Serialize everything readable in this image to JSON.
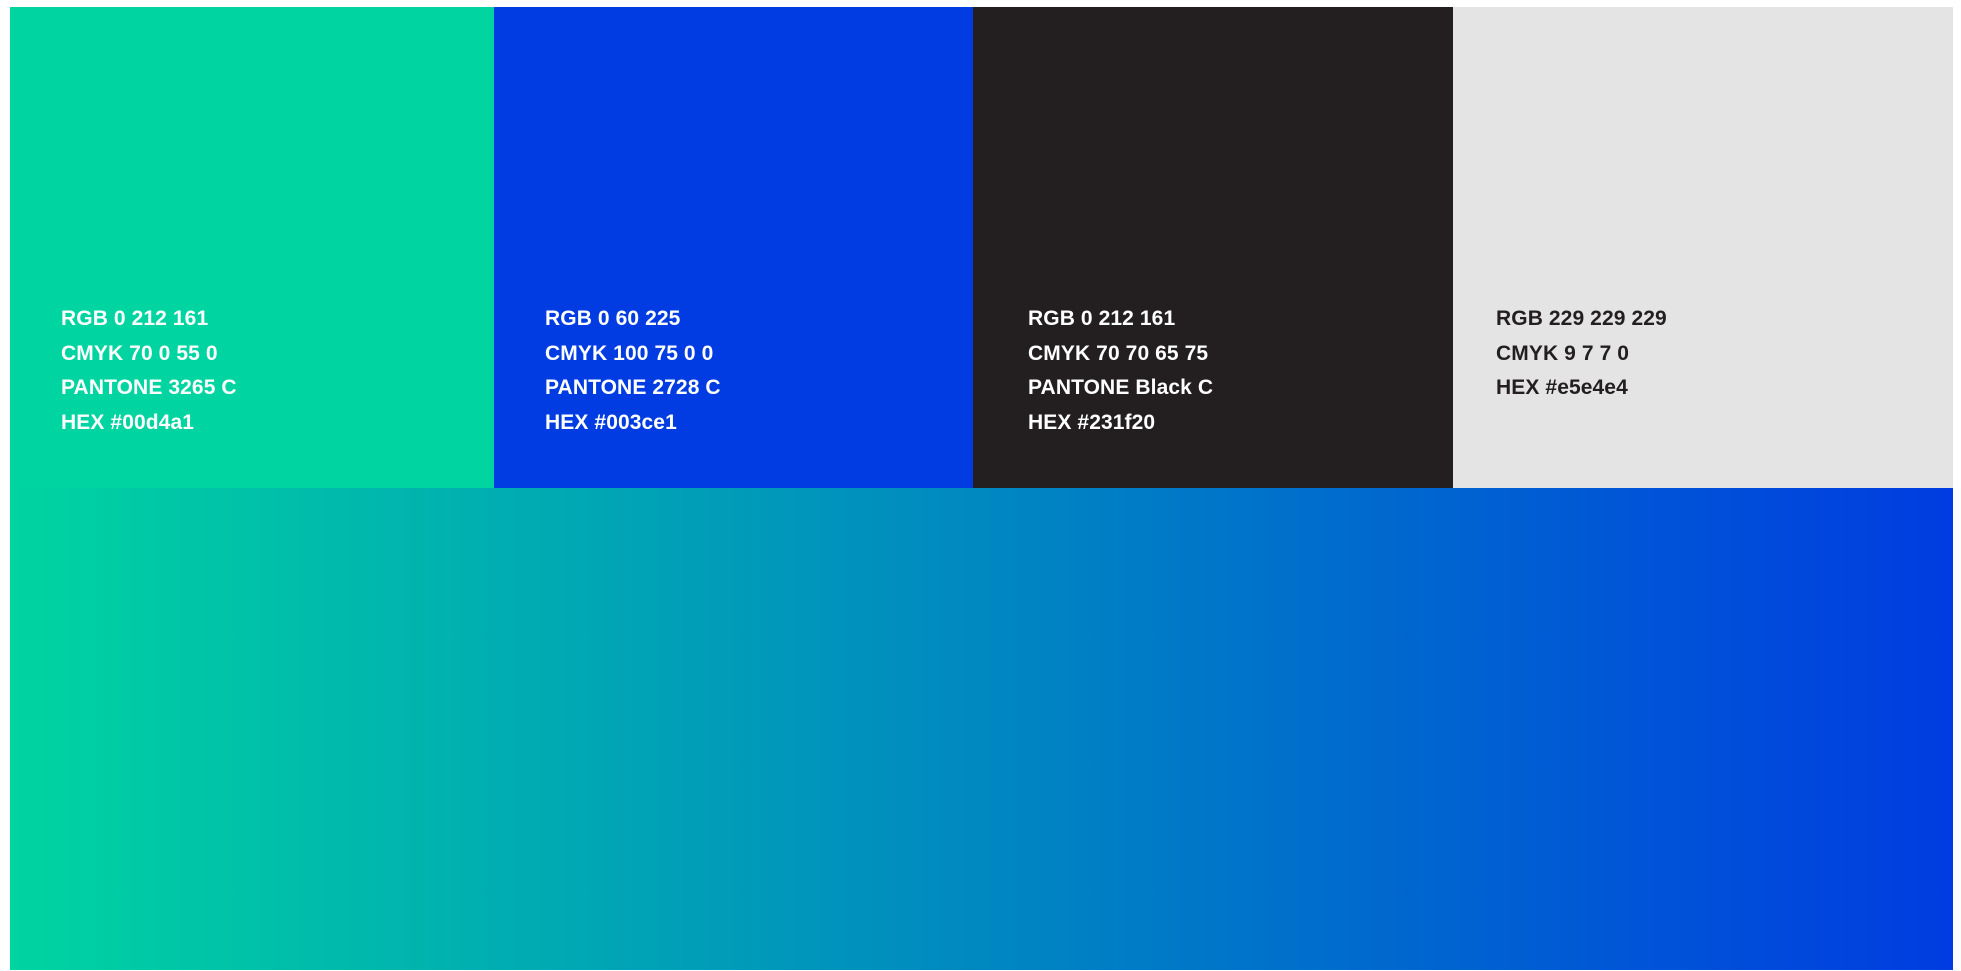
{
  "swatches": [
    {
      "color": "#00d4a1",
      "text_color": "#ffffff",
      "rgb": "RGB 0 212 161",
      "cmyk": "CMYK 70 0 55 0",
      "pantone": "PANTONE 3265 C",
      "hex": "HEX #00d4a1"
    },
    {
      "color": "#003ce1",
      "text_color": "#ffffff",
      "rgb": "RGB 0 60 225",
      "cmyk": "CMYK 100 75 0 0",
      "pantone": "PANTONE 2728 C",
      "hex": "HEX #003ce1"
    },
    {
      "color": "#231f20",
      "text_color": "#ffffff",
      "rgb": "RGB 0 212 161",
      "cmyk": "CMYK 70 70 65 75",
      "pantone": "PANTONE Black C",
      "hex": "HEX #231f20"
    },
    {
      "color": "#e5e4e4",
      "text_color": "#231f20",
      "rgb": "RGB 229 229 229",
      "cmyk": "CMYK 9 7 7 0",
      "hex": "HEX #e5e4e4"
    }
  ],
  "gradient": {
    "from": "#00d4a1",
    "to": "#003ce1"
  }
}
